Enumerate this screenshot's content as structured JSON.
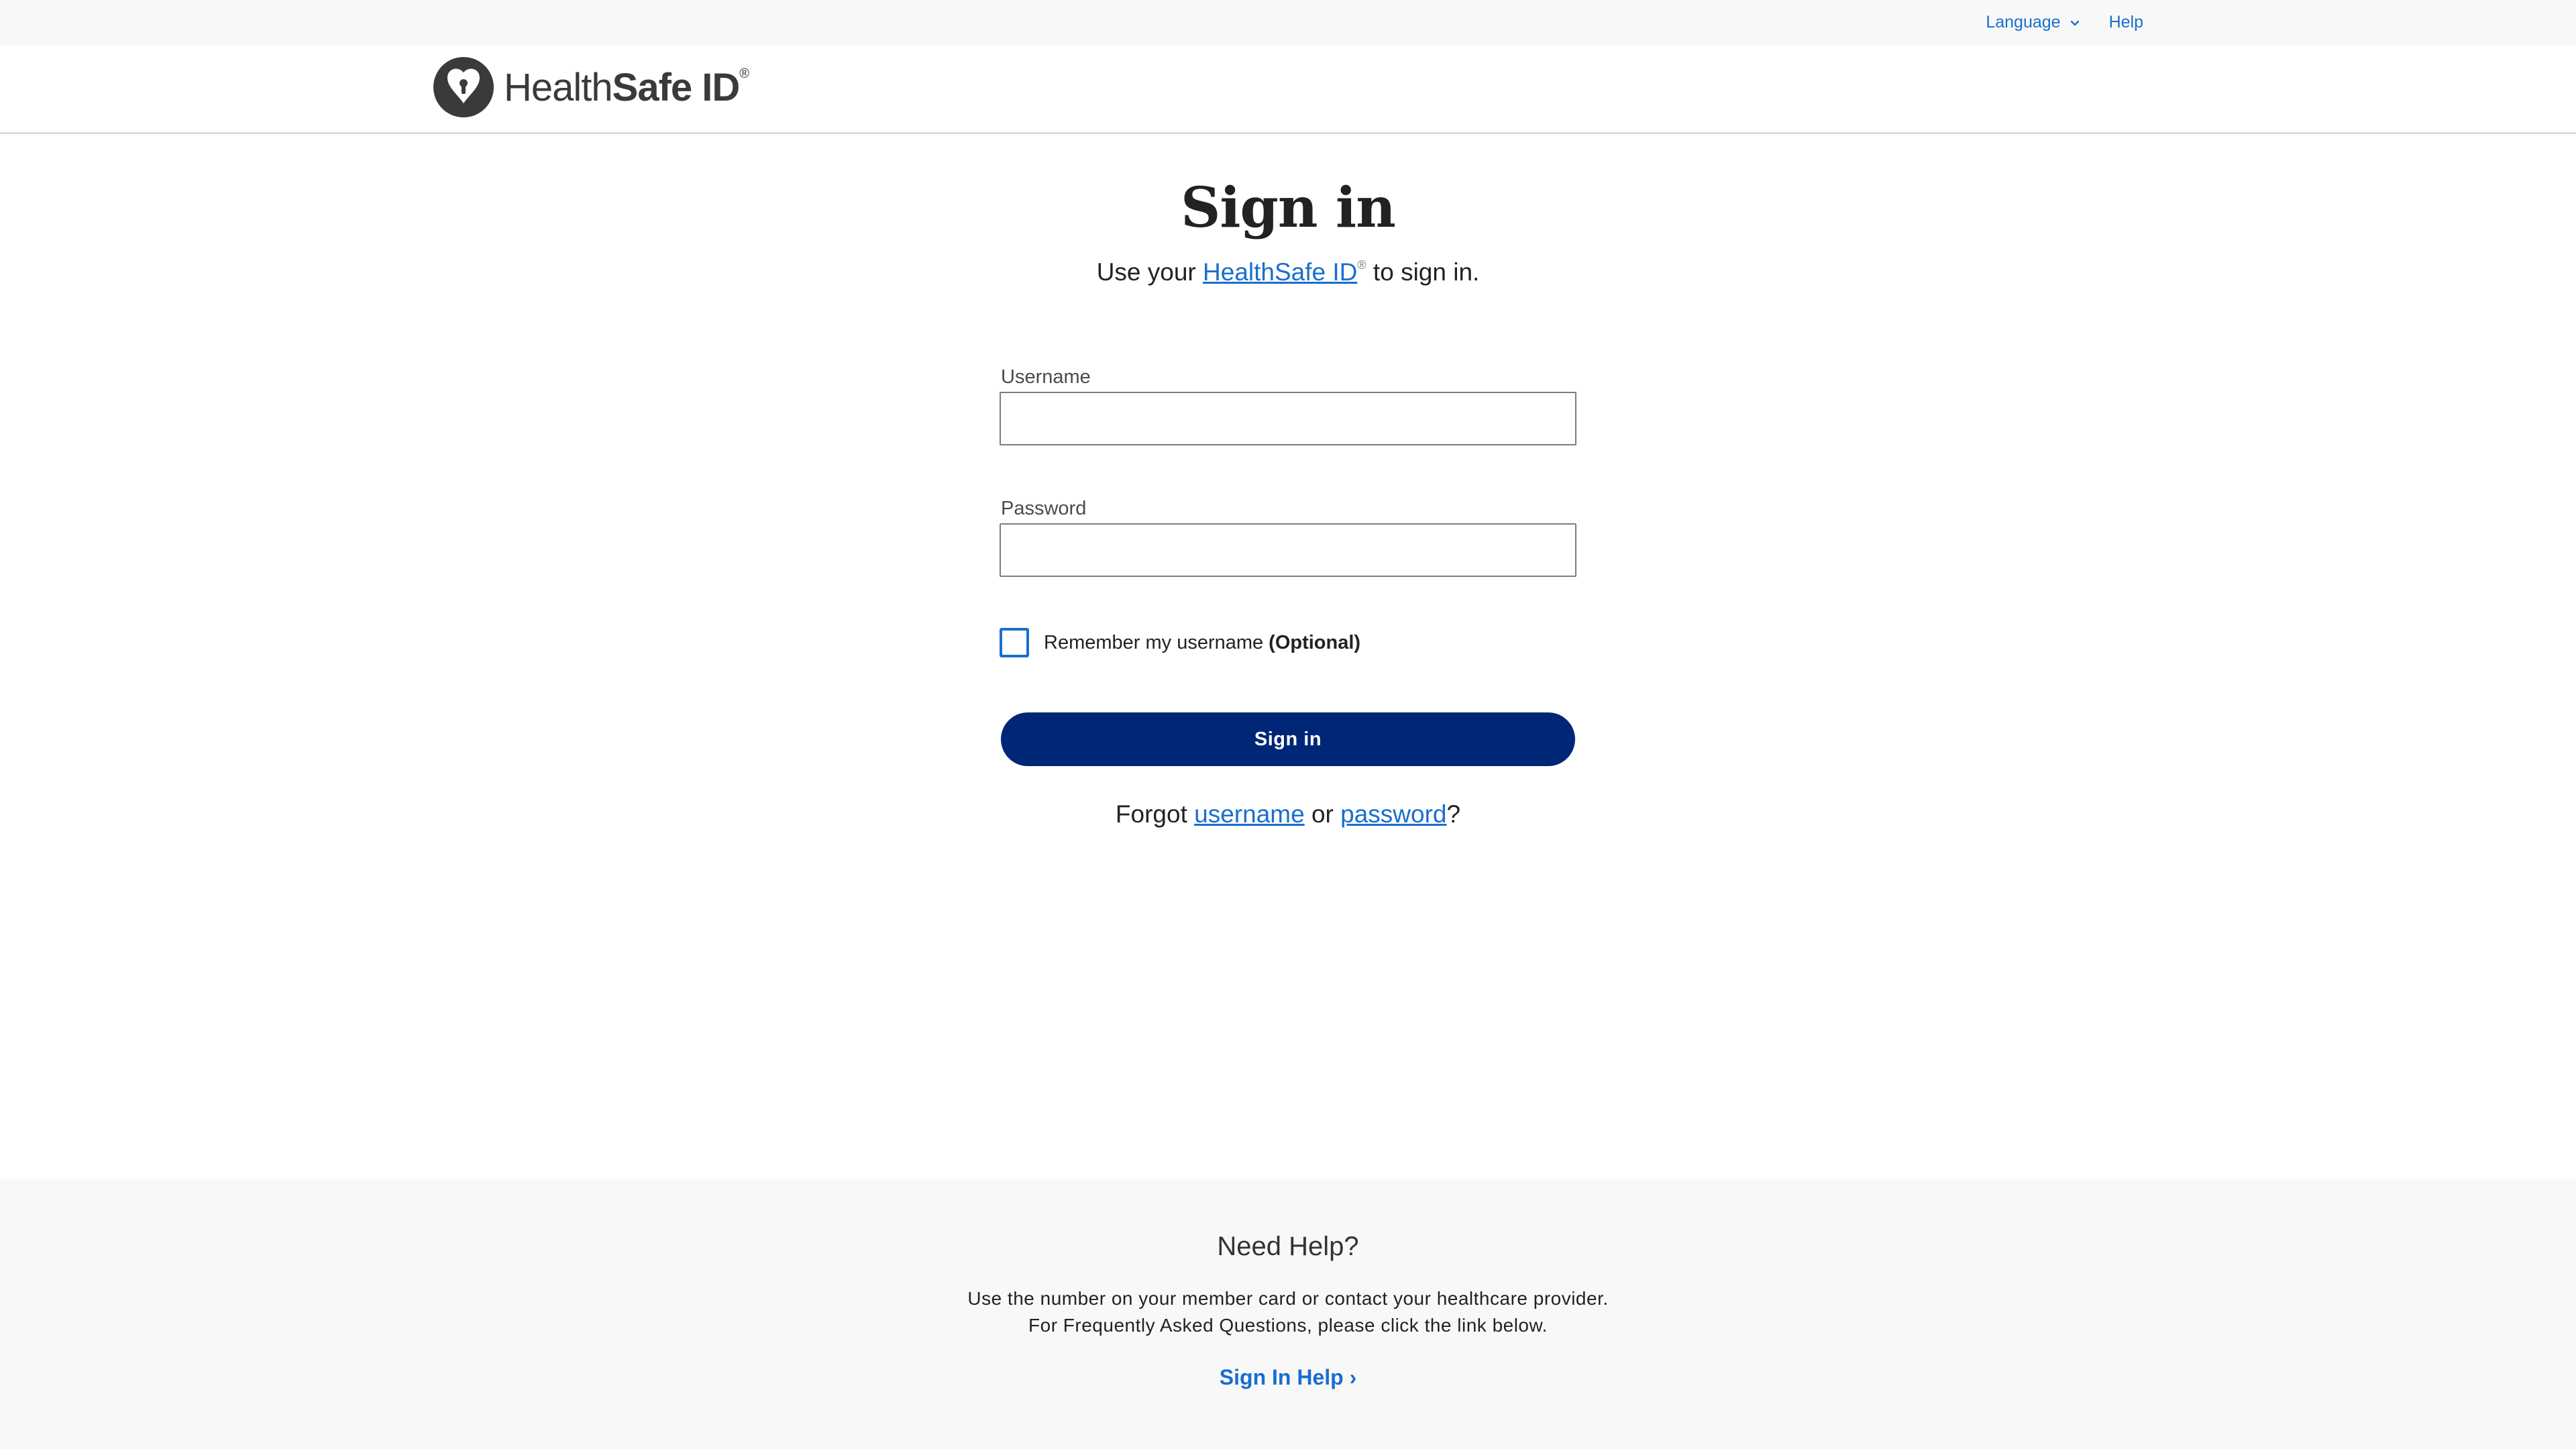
{
  "utility": {
    "language_label": "Language",
    "help_label": "Help"
  },
  "header": {
    "logo_text_light": "Health",
    "logo_text_bold": "Safe ID",
    "logo_reg": "®"
  },
  "main": {
    "title": "Sign in",
    "subtitle_prefix": "Use your ",
    "subtitle_link": "HealthSafe ID",
    "subtitle_reg": "®",
    "subtitle_suffix": " to sign in.",
    "username_label": "Username",
    "username_value": "",
    "password_label": "Password",
    "password_value": "",
    "remember_label": "Remember my username",
    "remember_optional": "(Optional)",
    "remember_checked": false,
    "signin_button": "Sign in",
    "forgot_prefix": "Forgot ",
    "forgot_username": "username",
    "forgot_or": " or ",
    "forgot_password": "password",
    "forgot_suffix": "?"
  },
  "footer": {
    "title": "Need Help?",
    "line1": "Use the number on your member card or contact your healthcare provider.",
    "line2": "For Frequently Asked Questions, please click the link below.",
    "help_link": "Sign In Help ›"
  },
  "colors": {
    "accent": "#196ecf",
    "primary_button": "#002677",
    "footer_bg": "#f8f8f8"
  },
  "icons": [
    "chevron-down-icon",
    "healthsafe-logo-icon"
  ]
}
